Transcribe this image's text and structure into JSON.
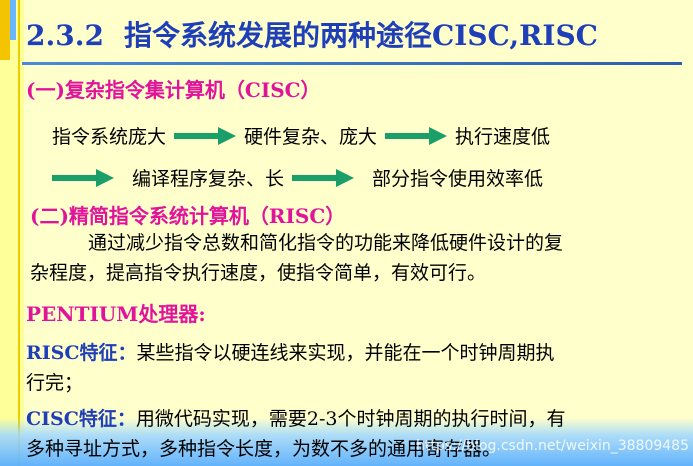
{
  "title": {
    "number": "2.3.2",
    "text": "指令系统发展的两种途径CISC,RISC"
  },
  "cisc_heading": "(一)复杂指令集计算机（CISC）",
  "flow_row1": {
    "a": "指令系统庞大",
    "b": "硬件复杂、庞大",
    "c": "执行速度低"
  },
  "flow_row2": {
    "a": "编译程序复杂、长",
    "b": "部分指令使用效率低"
  },
  "risc_heading": "(二)精简指令系统计算机（RISC）",
  "risc_desc_line1": "通过减少指令总数和简化指令的功能来降低硬件设计的复",
  "risc_desc_line2": "杂程度，提高指令执行速度，使指令简单，有效可行。",
  "pentium_label": "PENTIUM处理器:",
  "risc_feature": {
    "label": "RISC特征：",
    "line1": "某些指令以硬连线来实现，并能在一个时钟周期执",
    "line2": "行完；"
  },
  "cisc_feature": {
    "label": "CISC特征：",
    "line1": "用微代码实现，需要2-3个时钟周期的执行时间，有",
    "line2": "多种寻址方式，多种指令长度，为数不多的通用寄存器。"
  },
  "watermark": "https://blog.csdn.net/weixin_38809485",
  "colors": {
    "background": "#ffffcc",
    "title": "#1f3fb8",
    "heading": "#e0149a",
    "arrow": "#1a9e6a"
  },
  "icons": [
    "right-arrow-icon"
  ]
}
